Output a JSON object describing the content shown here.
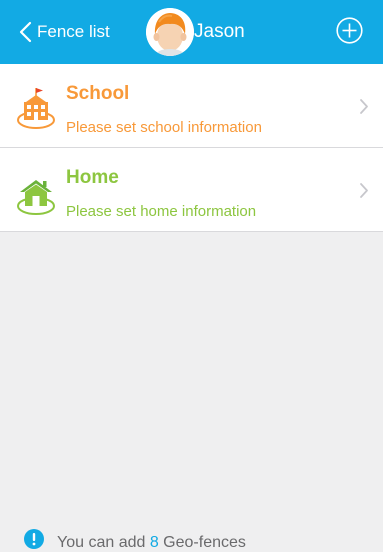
{
  "header": {
    "back_label": "Fence list",
    "title": "Jason",
    "accent_color": "#12aae4",
    "back_icon": "chevron-left-icon",
    "add_icon": "plus-circle-icon"
  },
  "fences": [
    {
      "title": "School",
      "subtitle": "Please set school information",
      "color": "#f89939",
      "icon": "school-icon"
    },
    {
      "title": "Home",
      "subtitle": "Please set home information",
      "color": "#8dc640",
      "icon": "home-icon"
    }
  ],
  "footer": {
    "text_before": "You can add ",
    "count": "8",
    "text_after": " Geo-fences",
    "icon": "info-icon"
  }
}
